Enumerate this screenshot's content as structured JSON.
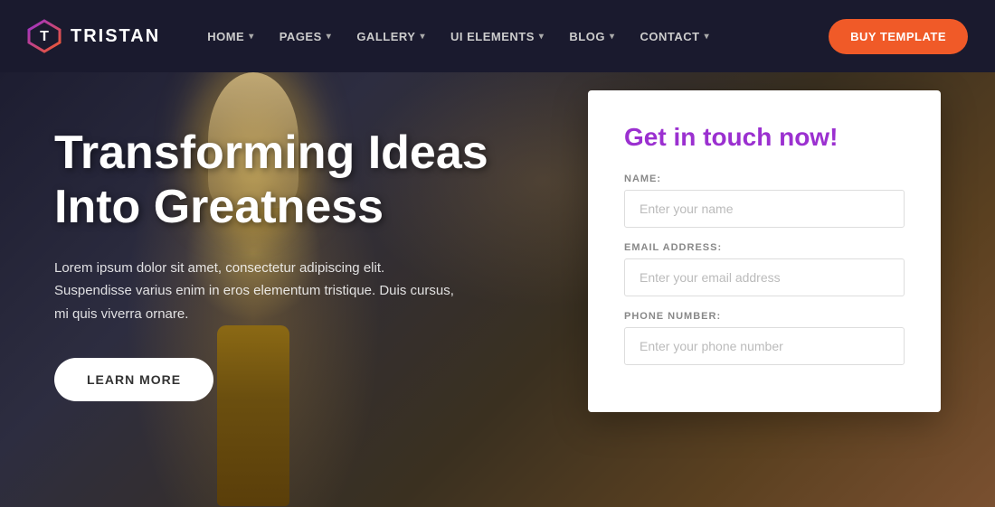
{
  "navbar": {
    "logo_text": "TRISTAN",
    "nav_items": [
      {
        "label": "HOME",
        "has_dropdown": true
      },
      {
        "label": "PAGES",
        "has_dropdown": true
      },
      {
        "label": "GALLERY",
        "has_dropdown": true
      },
      {
        "label": "UI ELEMENTS",
        "has_dropdown": true
      },
      {
        "label": "BLOG",
        "has_dropdown": true
      },
      {
        "label": "CONTACT",
        "has_dropdown": true
      }
    ],
    "buy_button_label": "BUY TEMPLATE"
  },
  "hero": {
    "title": "Transforming Ideas Into Greatness",
    "description": "Lorem ipsum dolor sit amet, consectetur adipiscing elit. Suspendisse varius enim in eros elementum tristique. Duis cursus, mi quis viverra ornare.",
    "learn_more_label": "LEARN MORE"
  },
  "contact_form": {
    "title": "Get in touch now!",
    "name_label": "NAME:",
    "name_placeholder": "Enter your name",
    "email_label": "EMAIL ADDRESS:",
    "email_placeholder": "Enter your email address",
    "phone_label": "PHONE NUMBER:",
    "phone_placeholder": "Enter your phone number"
  },
  "colors": {
    "accent_orange": "#f05a28",
    "accent_purple": "#9b30d0",
    "navbar_bg": "#1a1a2e"
  }
}
